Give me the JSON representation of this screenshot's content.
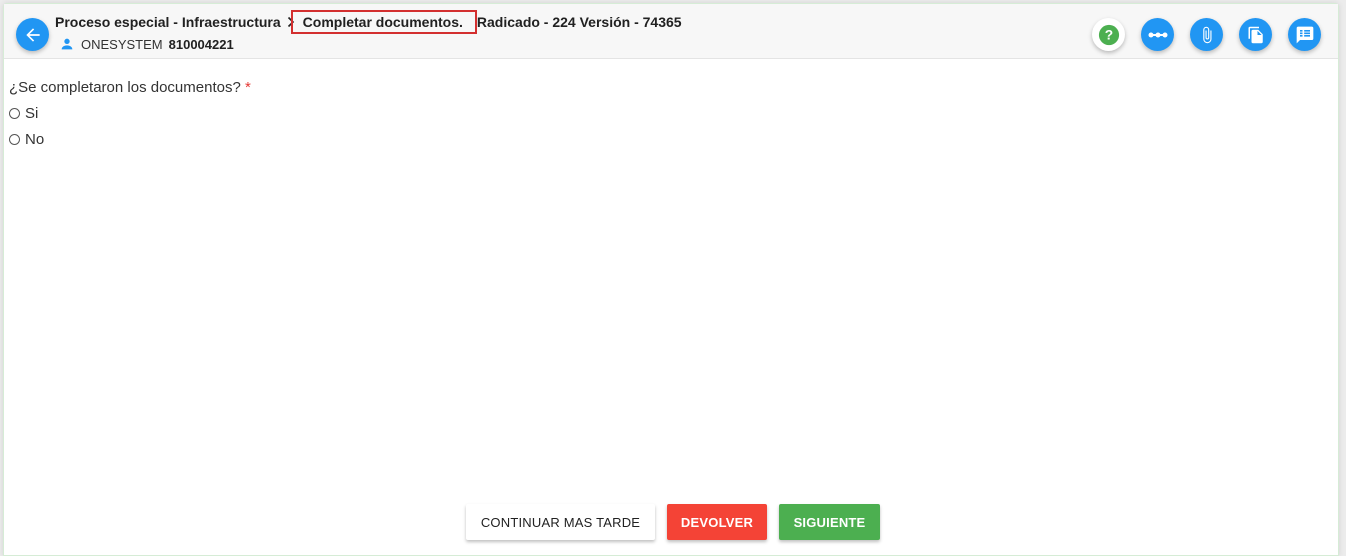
{
  "header": {
    "process": "Proceso especial - Infraestructura",
    "task": "Completar documentos.",
    "radicado": "Radicado - 224 Versión - 74365",
    "company": "ONESYSTEM",
    "nit": "810004221"
  },
  "toolbar": {
    "icons": [
      "help-icon",
      "more-horizontal-icon",
      "paperclip-icon",
      "documents-icon",
      "comments-icon"
    ]
  },
  "form": {
    "question": "¿Se completaron los documentos?",
    "required_mark": "*",
    "options": [
      "Si",
      "No"
    ]
  },
  "actions": {
    "later": "CONTINUAR MAS TARDE",
    "return": "DEVOLVER",
    "next": "SIGUIENTE"
  },
  "colors": {
    "primary": "#2196f3",
    "danger": "#f44336",
    "success": "#4caf50",
    "highlight": "#d32f2f",
    "help": "#4caf50"
  }
}
